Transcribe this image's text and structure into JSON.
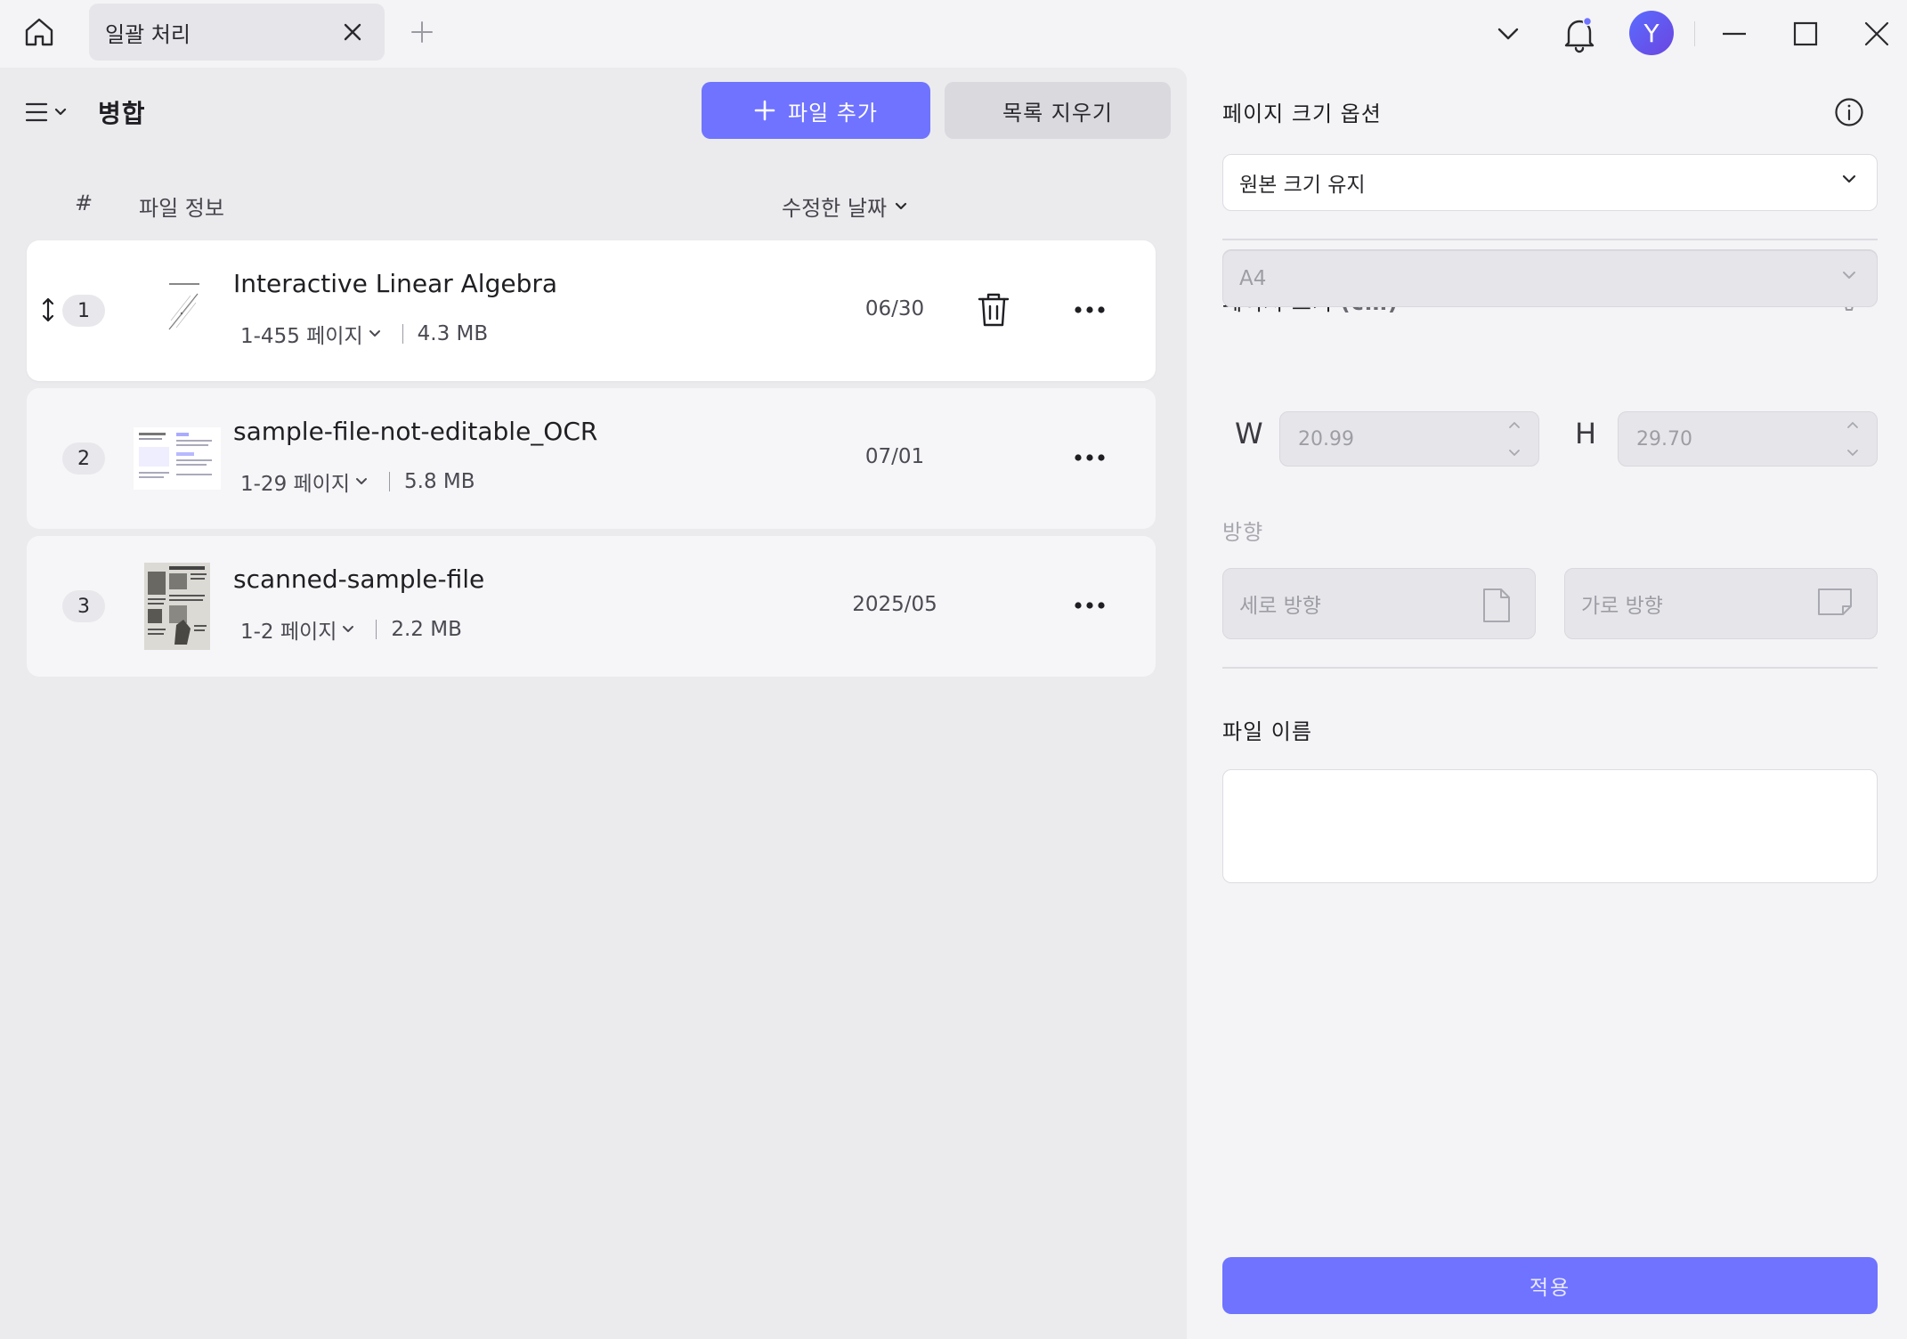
{
  "titlebar": {
    "tab_label": "일괄 처리",
    "avatar_initial": "Y"
  },
  "left": {
    "mode_title": "병합",
    "add_file_label": "파일 추가",
    "clear_list_label": "목록 지우기",
    "columns": {
      "num": "#",
      "info": "파일 정보",
      "date": "수정한 날짜"
    },
    "files": [
      {
        "index": "1",
        "name": "Interactive Linear Algebra",
        "pages": "1-455 페이지",
        "size": "4.3 MB",
        "date": "06/30"
      },
      {
        "index": "2",
        "name": "sample-file-not-editable_OCR",
        "pages": "1-29 페이지",
        "size": "5.8 MB",
        "date": "07/01"
      },
      {
        "index": "3",
        "name": "scanned-sample-file",
        "pages": "1-2 페이지",
        "size": "2.2 MB",
        "date": "2025/05"
      }
    ]
  },
  "right": {
    "page_size_option_title": "페이지 크기 옵션",
    "page_size_option_value": "원본 크기 유지",
    "page_size_title": "페이지 크기",
    "page_size_unit": "(cm)",
    "paper_value": "A4",
    "width_label": "W",
    "width_value": "20.99",
    "height_label": "H",
    "height_value": "29.70",
    "orientation_title": "방향",
    "portrait_label": "세로 방향",
    "landscape_label": "가로 방향",
    "file_name_title": "파일 이름",
    "file_name_value": "",
    "apply_label": "적용"
  },
  "colors": {
    "accent": "#6f73ff",
    "avatar": "#5a6cff",
    "notification_dot": "#6f73ff"
  }
}
